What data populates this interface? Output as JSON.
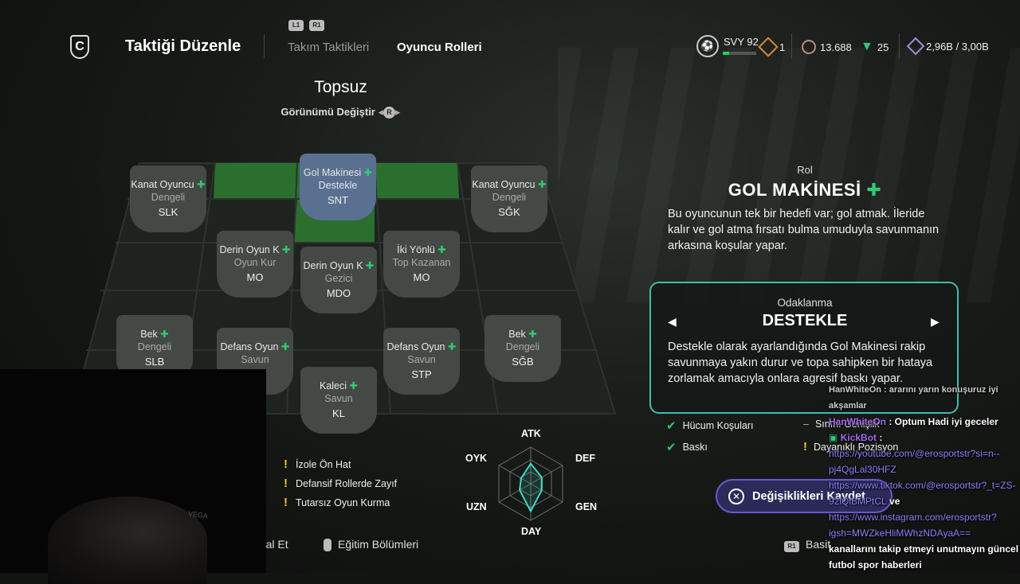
{
  "header": {
    "title": "Taktiği Düzenle",
    "button_l1": "L1",
    "button_r1": "R1",
    "tabs": [
      {
        "label": "Takım Taktikleri",
        "active": false
      },
      {
        "label": "Oyuncu Rolleri",
        "active": true
      }
    ],
    "level_label": "SVY 92",
    "ap_value": "1",
    "coins": "13.688",
    "points": "25",
    "sp": "2,96B / 3,00B"
  },
  "formation": {
    "name": "Topsuz",
    "change_view": "Görünümü Değiştir",
    "r_badge": "R",
    "players": [
      {
        "name": "Kanat Oyuncu",
        "role": "Dengeli",
        "pos": "SLK"
      },
      {
        "name": "Gol Makinesi",
        "role": "Destekle",
        "pos": "SNT"
      },
      {
        "name": "Kanat Oyuncu",
        "role": "Dengeli",
        "pos": "SĞK"
      },
      {
        "name": "Derin Oyun K",
        "role": "Oyun Kur",
        "pos": "MO"
      },
      {
        "name": "Derin Oyun K",
        "role": "Gezici",
        "pos": "MDO"
      },
      {
        "name": "İki Yönlü",
        "role": "Top Kazanan",
        "pos": "MO"
      },
      {
        "name": "Bek",
        "role": "Dengeli",
        "pos": "SLB"
      },
      {
        "name": "Defans Oyun",
        "role": "Savun",
        "pos": "STP"
      },
      {
        "name": "Defans Oyun",
        "role": "Savun",
        "pos": "STP"
      },
      {
        "name": "Bek",
        "role": "Dengeli",
        "pos": "SĞB"
      },
      {
        "name": "Kaleci",
        "role": "Savun",
        "pos": "KL"
      }
    ]
  },
  "role_panel": {
    "label": "Rol",
    "name": "GOL MAKİNESİ",
    "description": "Bu oyuncunun tek bir hedefi var; gol atmak. İleride kalır ve gol atma fırsatı bulma umuduyla savunmanın arkasına koşular yapar.",
    "focus_label": "Odaklanma",
    "focus_value": "DESTEKLE",
    "focus_description": "Destekle olarak ayarlandığında Gol Makinesi rakip savunmaya yakın durur ve topa sahipken bir hataya zorlamak amacıyla onlara agresif baskı yapar.",
    "traits": [
      {
        "label": "Hücum Koşuları",
        "type": "check"
      },
      {
        "label": "Sınırlı Genişlik",
        "type": "dash"
      },
      {
        "label": "Baskı",
        "type": "check"
      },
      {
        "label": "Dayanıklı Pozisyon",
        "type": "warn"
      }
    ]
  },
  "weaknesses": [
    "İzole Ön Hat",
    "Defansif Rollerde Zayıf",
    "Tutarsız Oyun Kurma"
  ],
  "radar": {
    "labels": {
      "atk": "ATK",
      "def": "DEF",
      "gen": "GEN",
      "day": "DAY",
      "uzn": "UZN",
      "oyk": "OYK"
    },
    "values": [
      0.55,
      0.35,
      0.35,
      0.75,
      0.35,
      0.3
    ]
  },
  "save_button": "Değişiklikleri Kaydet",
  "bottom": {
    "cancel": "İptal Et",
    "training": "Eğitim Bölümleri",
    "r1": "R1",
    "basic": "Basit"
  },
  "webcam": {
    "cap_text": "VEGA"
  },
  "chat": {
    "line1": "HanWhiteOn : ararını yarın konuşuruz iyi akşamlar",
    "user2": "HanWhiteOn",
    "msg2": ": Optum Hadi iyi geceler",
    "user3": "KickBot",
    "link1": "https://youtube.com/@erosportstr?si=n--pj4QgLal30HFZ",
    "link2": "https://www.tiktok.com/@erosportstr?_t=ZS-92lQiBMPtCL",
    "and": "ve",
    "link3": "https://www.instagram.com/erosportstr?igsh=MWZkeHliMWhzNDAyaA==",
    "tail": "kanallarını takip etmeyi unutmayın güncel futbol spor haberleri"
  }
}
